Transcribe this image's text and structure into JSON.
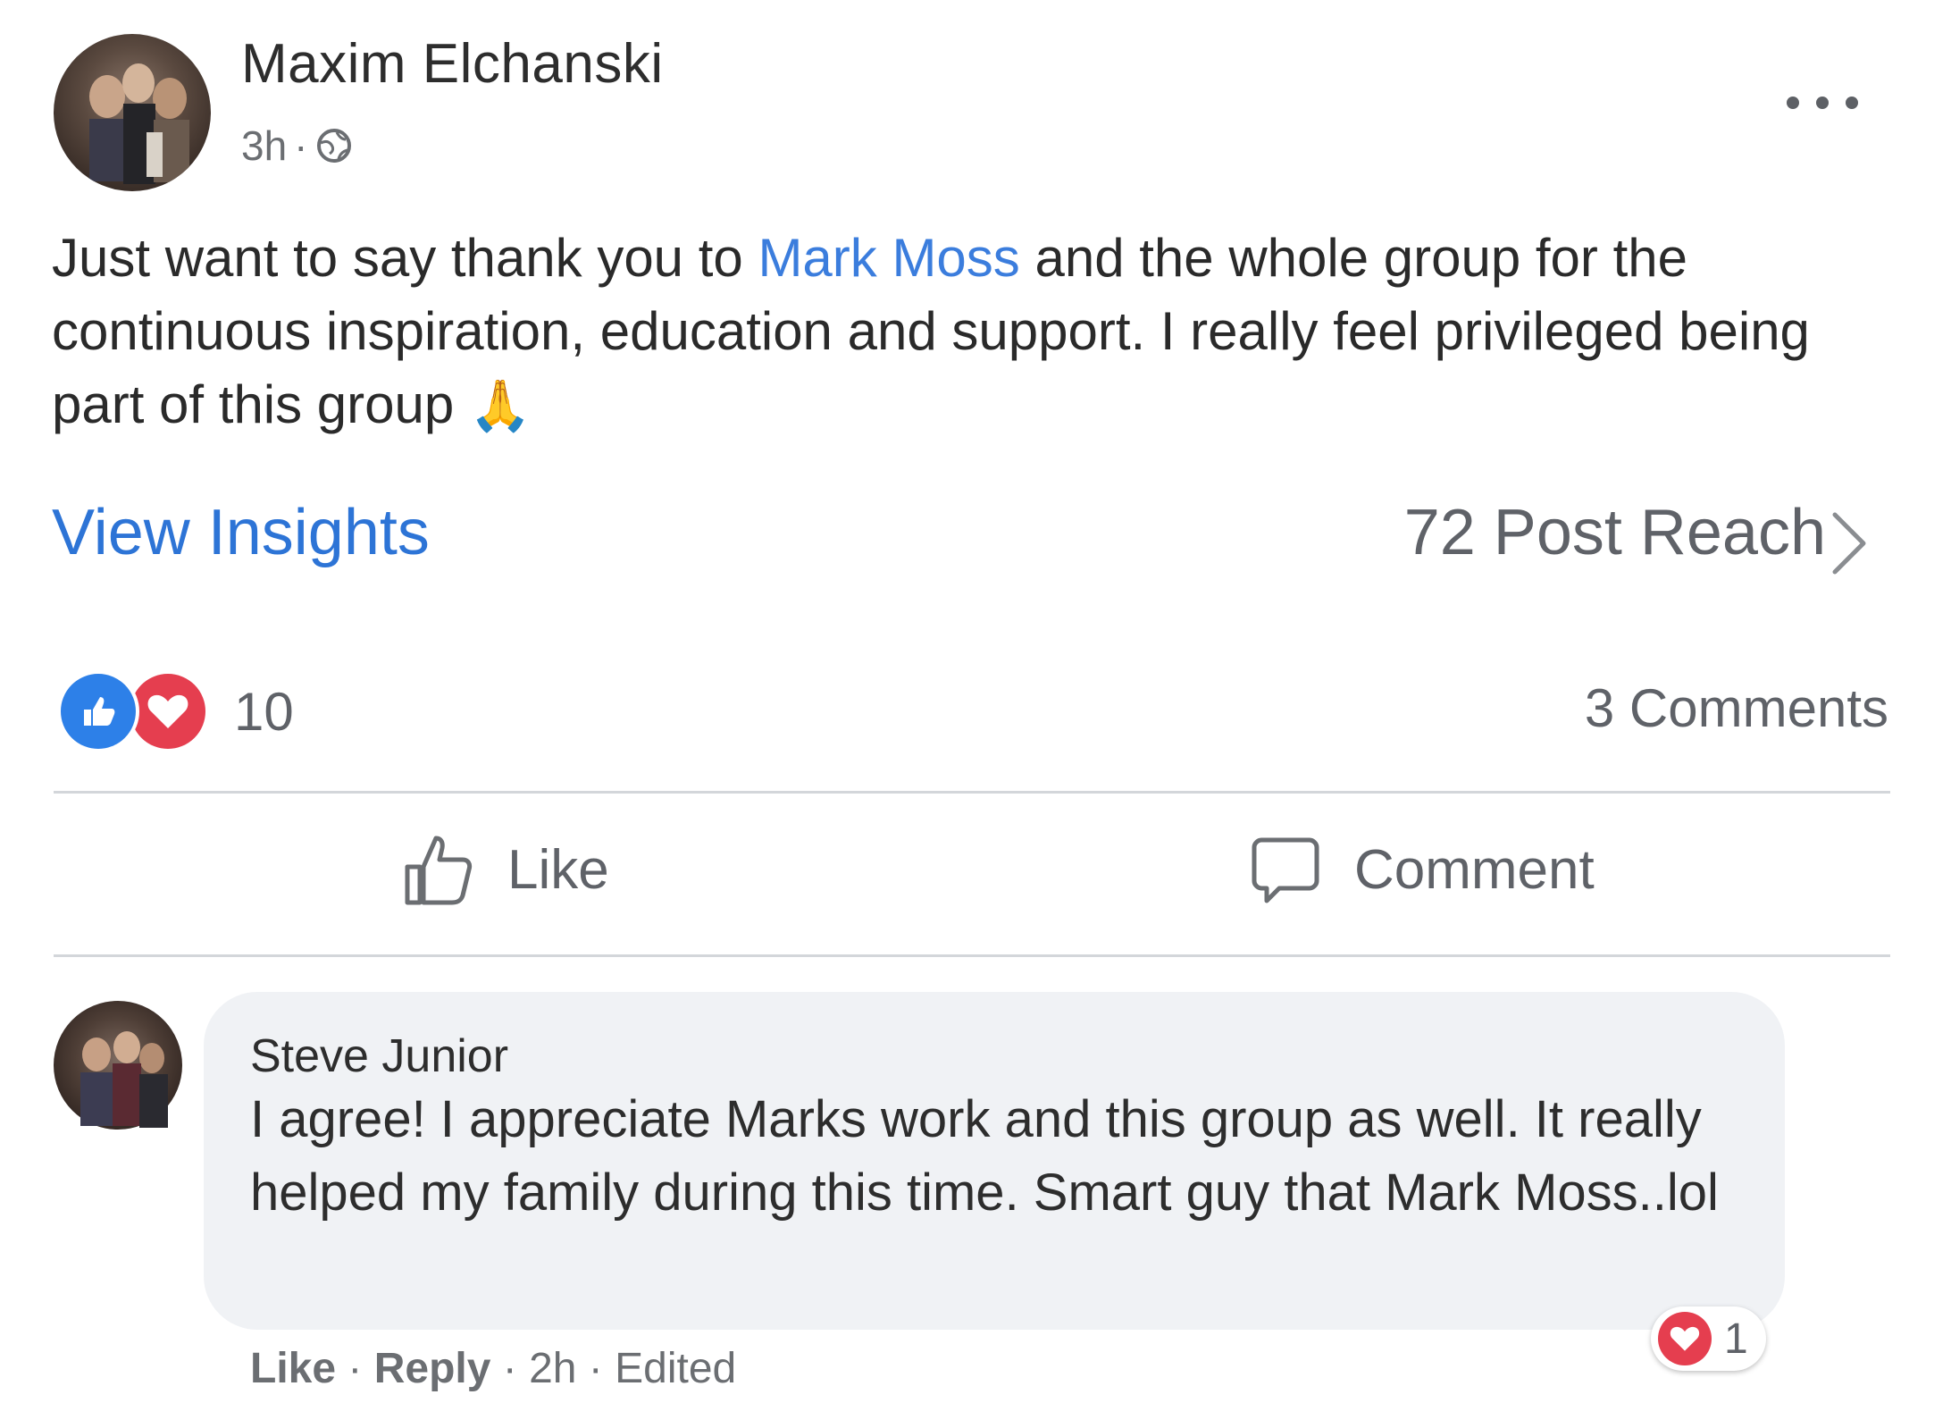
{
  "post": {
    "author": "Maxim Elchanski",
    "time": "3h",
    "separator": "·",
    "more_icon": "more-horizontal-icon",
    "privacy_icon": "globe-icon",
    "text_before_mention": "Just want to say thank you to ",
    "mention": "Mark Moss",
    "text_after_mention": " and the whole group for the continuous inspiration, education and support. I really feel privileged being part of this group ",
    "emoji": "🙏",
    "view_insights": "View Insights",
    "post_reach": "72 Post Reach",
    "reaction_count": "10",
    "comments_count": "3 Comments",
    "like_label": "Like",
    "comment_label": "Comment"
  },
  "comment": {
    "author": "Steve Junior",
    "text": "I agree! I appreciate Marks work and this group as well. It really helped my family during this time. Smart guy that Mark Moss..lol",
    "like": "Like",
    "reply": "Reply",
    "time": "2h",
    "edited": "Edited",
    "sep": " · ",
    "reaction_count": "1"
  },
  "colors": {
    "link": "#2d74d6",
    "like_blue": "#2d80e8",
    "love_red": "#e53e4f",
    "bubble_bg": "#f0f2f5"
  }
}
